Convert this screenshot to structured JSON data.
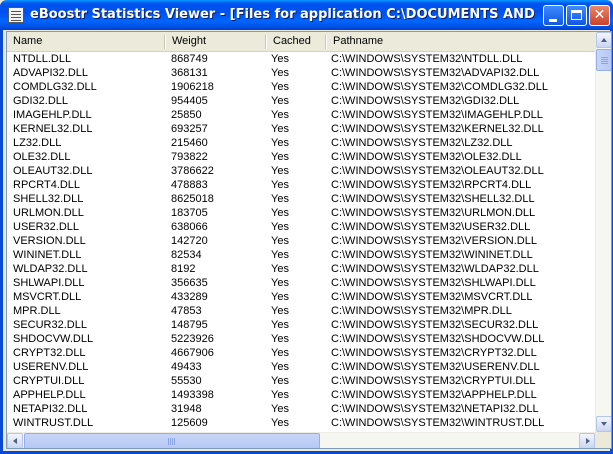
{
  "window": {
    "title": "eBoostr Statistics Viewer - [Files for application C:\\DOCUMENTS AND SETTINGS\\Z..."
  },
  "columns": [
    "Name",
    "Weight",
    "Cached",
    "Pathname"
  ],
  "rows": [
    {
      "name": "NTDLL.DLL",
      "weight": "868749",
      "cached": "Yes",
      "path": "C:\\WINDOWS\\SYSTEM32\\NTDLL.DLL"
    },
    {
      "name": "ADVAPI32.DLL",
      "weight": "368131",
      "cached": "Yes",
      "path": "C:\\WINDOWS\\SYSTEM32\\ADVAPI32.DLL"
    },
    {
      "name": "COMDLG32.DLL",
      "weight": "1906218",
      "cached": "Yes",
      "path": "C:\\WINDOWS\\SYSTEM32\\COMDLG32.DLL"
    },
    {
      "name": "GDI32.DLL",
      "weight": "954405",
      "cached": "Yes",
      "path": "C:\\WINDOWS\\SYSTEM32\\GDI32.DLL"
    },
    {
      "name": "IMAGEHLP.DLL",
      "weight": "25850",
      "cached": "Yes",
      "path": "C:\\WINDOWS\\SYSTEM32\\IMAGEHLP.DLL"
    },
    {
      "name": "KERNEL32.DLL",
      "weight": "693257",
      "cached": "Yes",
      "path": "C:\\WINDOWS\\SYSTEM32\\KERNEL32.DLL"
    },
    {
      "name": "LZ32.DLL",
      "weight": "215460",
      "cached": "Yes",
      "path": "C:\\WINDOWS\\SYSTEM32\\LZ32.DLL"
    },
    {
      "name": "OLE32.DLL",
      "weight": "793822",
      "cached": "Yes",
      "path": "C:\\WINDOWS\\SYSTEM32\\OLE32.DLL"
    },
    {
      "name": "OLEAUT32.DLL",
      "weight": "3786622",
      "cached": "Yes",
      "path": "C:\\WINDOWS\\SYSTEM32\\OLEAUT32.DLL"
    },
    {
      "name": "RPCRT4.DLL",
      "weight": "478883",
      "cached": "Yes",
      "path": "C:\\WINDOWS\\SYSTEM32\\RPCRT4.DLL"
    },
    {
      "name": "SHELL32.DLL",
      "weight": "8625018",
      "cached": "Yes",
      "path": "C:\\WINDOWS\\SYSTEM32\\SHELL32.DLL"
    },
    {
      "name": "URLMON.DLL",
      "weight": "183705",
      "cached": "Yes",
      "path": "C:\\WINDOWS\\SYSTEM32\\URLMON.DLL"
    },
    {
      "name": "USER32.DLL",
      "weight": "638066",
      "cached": "Yes",
      "path": "C:\\WINDOWS\\SYSTEM32\\USER32.DLL"
    },
    {
      "name": "VERSION.DLL",
      "weight": "142720",
      "cached": "Yes",
      "path": "C:\\WINDOWS\\SYSTEM32\\VERSION.DLL"
    },
    {
      "name": "WININET.DLL",
      "weight": "82534",
      "cached": "Yes",
      "path": "C:\\WINDOWS\\SYSTEM32\\WININET.DLL"
    },
    {
      "name": "WLDAP32.DLL",
      "weight": "8192",
      "cached": "Yes",
      "path": "C:\\WINDOWS\\SYSTEM32\\WLDAP32.DLL"
    },
    {
      "name": "SHLWAPI.DLL",
      "weight": "356635",
      "cached": "Yes",
      "path": "C:\\WINDOWS\\SYSTEM32\\SHLWAPI.DLL"
    },
    {
      "name": "MSVCRT.DLL",
      "weight": "433289",
      "cached": "Yes",
      "path": "C:\\WINDOWS\\SYSTEM32\\MSVCRT.DLL"
    },
    {
      "name": "MPR.DLL",
      "weight": "47853",
      "cached": "Yes",
      "path": "C:\\WINDOWS\\SYSTEM32\\MPR.DLL"
    },
    {
      "name": "SECUR32.DLL",
      "weight": "148795",
      "cached": "Yes",
      "path": "C:\\WINDOWS\\SYSTEM32\\SECUR32.DLL"
    },
    {
      "name": "SHDOCVW.DLL",
      "weight": "5223926",
      "cached": "Yes",
      "path": "C:\\WINDOWS\\SYSTEM32\\SHDOCVW.DLL"
    },
    {
      "name": "CRYPT32.DLL",
      "weight": "4667906",
      "cached": "Yes",
      "path": "C:\\WINDOWS\\SYSTEM32\\CRYPT32.DLL"
    },
    {
      "name": "USERENV.DLL",
      "weight": "49433",
      "cached": "Yes",
      "path": "C:\\WINDOWS\\SYSTEM32\\USERENV.DLL"
    },
    {
      "name": "CRYPTUI.DLL",
      "weight": "55530",
      "cached": "Yes",
      "path": "C:\\WINDOWS\\SYSTEM32\\CRYPTUI.DLL"
    },
    {
      "name": "APPHELP.DLL",
      "weight": "1493398",
      "cached": "Yes",
      "path": "C:\\WINDOWS\\SYSTEM32\\APPHELP.DLL"
    },
    {
      "name": "NETAPI32.DLL",
      "weight": "31948",
      "cached": "Yes",
      "path": "C:\\WINDOWS\\SYSTEM32\\NETAPI32.DLL"
    },
    {
      "name": "WINTRUST.DLL",
      "weight": "125609",
      "cached": "Yes",
      "path": "C:\\WINDOWS\\SYSTEM32\\WINTRUST.DLL"
    }
  ],
  "icons": {
    "app": "document-list-icon",
    "minimize": "minimize-icon",
    "maximize": "maximize-icon",
    "close": "close-icon"
  },
  "colors": {
    "titlebar": "#0054e3",
    "window_bg": "#ece9d8",
    "list_bg": "#ffffff"
  }
}
